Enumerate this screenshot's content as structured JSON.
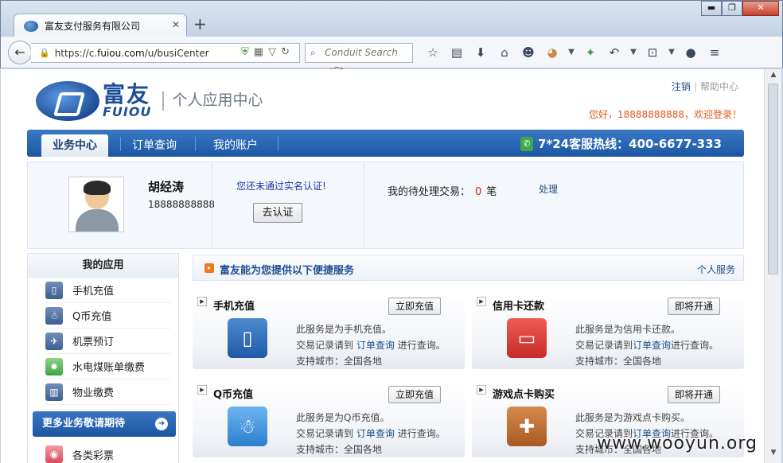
{
  "browser": {
    "tab_title": "富友支付服务有限公司",
    "new_tab": "+",
    "url_prefix": "https://c.",
    "url_host": "fuiou.com",
    "url_path": "/u/busiCenter",
    "search_placeholder": "Conduit Search <Ct",
    "window_controls": [
      "▬",
      "❐",
      "✕"
    ],
    "toolbar_icons": [
      "star-icon",
      "reading-list-icon",
      "download-icon",
      "home-icon",
      "smiley-icon",
      "addon-icon",
      "menu-arrow-icon",
      "extension-icon",
      "undo-icon",
      "crop-icon",
      "chat-icon",
      "hamburger-menu-icon"
    ]
  },
  "header": {
    "logout": "注销",
    "separator": "|",
    "help": "帮助中心",
    "logo_cn": "富友",
    "logo_en": "FUIOU",
    "subtitle": "个人应用中心",
    "welcome": "您好，18888888888，欢迎登录！"
  },
  "mainnav": {
    "items": [
      "业务中心",
      "订单查询",
      "我的账户"
    ],
    "active_index": 0,
    "hotline": "7*24客服热线：400-6677-333"
  },
  "profile": {
    "name": "胡经涛",
    "phone": "18888888888",
    "verify_message": "您还未通过实名认证!",
    "verify_button": "去认证",
    "pending_label": "我的待处理交易：",
    "pending_count": "0",
    "pending_unit": "笔",
    "process_link": "处理"
  },
  "sidebar": {
    "title": "我的应用",
    "items": [
      {
        "label": "手机充值",
        "icon": "mobile-phone-icon"
      },
      {
        "label": "Q币充值",
        "icon": "qq-penguin-icon"
      },
      {
        "label": "机票预订",
        "icon": "airplane-icon"
      },
      {
        "label": "水电煤账单缴费",
        "icon": "lightbulb-icon"
      },
      {
        "label": "物业缴费",
        "icon": "building-icon"
      }
    ],
    "more_button": "更多业务敬请期待",
    "lottery": "各类彩票"
  },
  "services": {
    "title": "富友能为您提供以下便捷服务",
    "personal_link": "个人服务",
    "cards": [
      {
        "name": "手机充值",
        "button": "立即充值",
        "desc1": "此服务是为手机充值。",
        "desc2_pre": "交易记录请到",
        "desc2_link": "订单查询",
        "desc2_post": "进行查询。",
        "desc3": "支持城市：全国各地",
        "icon": "mobile-phone-icon"
      },
      {
        "name": "信用卡还款",
        "button": "即将开通",
        "desc1": "此服务是为信用卡还款。",
        "desc2_pre": "交易记录请到",
        "desc2_link": "订单查询",
        "desc2_post": "进行查询。",
        "desc3": "支持城市：全国各地",
        "icon": "credit-card-icon"
      },
      {
        "name": "Q币充值",
        "button": "立即充值",
        "desc1": "此服务是为Q币充值。",
        "desc2_pre": "交易记录请到",
        "desc2_link": "订单查询",
        "desc2_post": "进行查询。",
        "desc3": "支持城市：全国各地",
        "icon": "qq-penguin-icon"
      },
      {
        "name": "游戏点卡购买",
        "button": "即将开通",
        "desc1": "此服务是为游戏点卡购买。",
        "desc2_pre": "交易记录请到",
        "desc2_link": "订单查询",
        "desc2_post": "进行查询。",
        "desc3": "支持城市：全国各地",
        "icon": "gamepad-icon"
      }
    ]
  },
  "watermark": "www.wooyun.org"
}
